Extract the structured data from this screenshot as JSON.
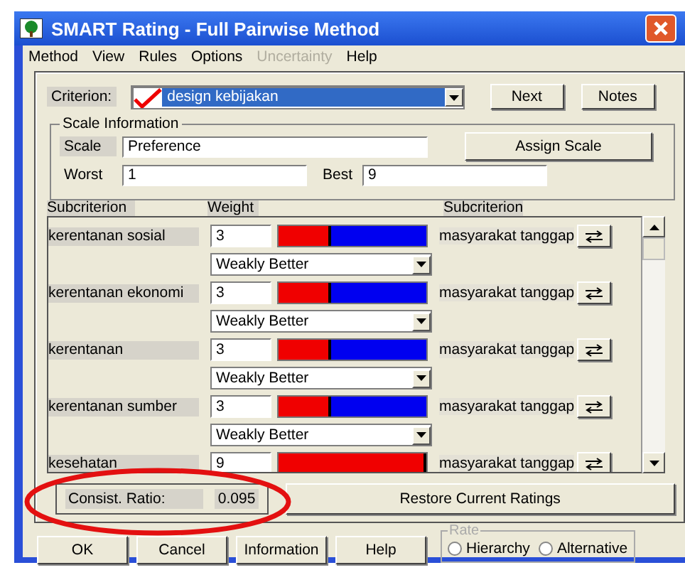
{
  "window": {
    "title": "SMART Rating - Full Pairwise Method"
  },
  "menu": [
    {
      "label": "Method",
      "disabled": false
    },
    {
      "label": "View",
      "disabled": false
    },
    {
      "label": "Rules",
      "disabled": false
    },
    {
      "label": "Options",
      "disabled": false
    },
    {
      "label": "Uncertainty",
      "disabled": true
    },
    {
      "label": "Help",
      "disabled": false
    }
  ],
  "criterion": {
    "label": "Criterion:",
    "value": "design kebijakan"
  },
  "top_buttons": [
    "Next",
    "Notes"
  ],
  "scale_information": {
    "title": "Scale Information",
    "scale_label": "Scale",
    "scale": "Preference",
    "assign_button": "Assign Scale",
    "worst_label": "Worst",
    "worst": "1",
    "best_label": "Best",
    "best": "9"
  },
  "table": {
    "columns": [
      "Subcriterion",
      "Weight",
      "Subcriterion"
    ],
    "rows": [
      {
        "name": "kerentanan sosial",
        "weight": "3",
        "level": 0.36,
        "comparison": "Weakly Better",
        "other": "masyarakat tanggap"
      },
      {
        "name": "kerentanan ekonomi",
        "weight": "3",
        "level": 0.36,
        "comparison": "Weakly Better",
        "other": "masyarakat tanggap"
      },
      {
        "name": "kerentanan",
        "weight": "3",
        "level": 0.36,
        "comparison": "Weakly Better",
        "other": "masyarakat tanggap"
      },
      {
        "name": "kerentanan sumber",
        "weight": "3",
        "level": 0.36,
        "comparison": "Weakly Better",
        "other": "masyarakat tanggap"
      },
      {
        "name": "kesehatan",
        "weight": "9",
        "level": 1,
        "other": "masyarakat tanggap"
      }
    ]
  },
  "consistency": {
    "label": "Consist. Ratio:",
    "value": "0.095"
  },
  "restore_button": "Restore Current Ratings",
  "footer_buttons": [
    "OK",
    "Cancel",
    "Information",
    "Help"
  ],
  "rate": {
    "title": "Rate",
    "disabled": true,
    "options": [
      {
        "label": "Hierarchy",
        "selected": false
      },
      {
        "label": "Alternative",
        "selected": false
      }
    ]
  }
}
